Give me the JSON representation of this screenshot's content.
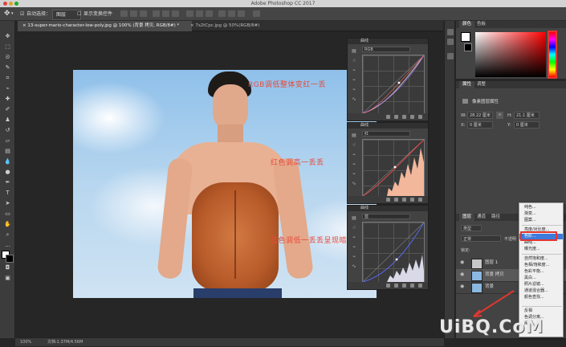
{
  "app": {
    "title": "Adobe Photoshop CC 2017"
  },
  "options_bar": {
    "auto_select_label": "自动选择：",
    "auto_select_value": "图层",
    "show_transform_label": "显示变换控件"
  },
  "tabs": [
    {
      "label": "13-super-mario-character-low-poly.jpg @ 100% (背景 拷贝, RGB/8#) *",
      "active": true
    },
    {
      "label": "7s2tCpc.jpg @ 50%(RGB/8#)",
      "active": false
    }
  ],
  "annotations": [
    "RGB调低整体变红一丢",
    "红色调高一丢丢",
    "蓝色调低一丢丢呈现暗黄小麦色"
  ],
  "curves_panels": [
    {
      "title": "曲线",
      "channel": "RGB"
    },
    {
      "title": "曲线",
      "channel": "红"
    },
    {
      "title": "曲线",
      "channel": "蓝"
    }
  ],
  "color_panel": {
    "tabs": [
      "颜色",
      "色板"
    ]
  },
  "properties_panel": {
    "tabs": [
      "属性",
      "调整"
    ],
    "pixel_layer_label": "像素图层属性",
    "w_label": "W:",
    "w_value": "28.22 厘米",
    "h_label": "H:",
    "h_value": "21.1 厘米",
    "x_label": "X:",
    "x_value": "0 厘米",
    "y_label": "Y:",
    "y_value": "0 厘米"
  },
  "layers_panel": {
    "tabs": [
      "图层",
      "通道",
      "路径"
    ],
    "filter_value": "类型",
    "blend_mode": "正常",
    "opacity_label": "不透明",
    "lock_label": "锁定:",
    "layers": [
      {
        "name": "图层 1"
      },
      {
        "name": "背景 拷贝"
      },
      {
        "name": "背景"
      }
    ]
  },
  "context_menu": {
    "items": [
      "纯色...",
      "渐变...",
      "图案...",
      "亮度/对比度...",
      "色阶...",
      "曲线...",
      "曝光度...",
      "自然饱和度...",
      "色相/饱和度...",
      "色彩平衡...",
      "黑白...",
      "照片滤镜...",
      "通道混合器...",
      "颜色查找...",
      "反相",
      "色调分离...",
      "阈值..."
    ],
    "selected_index": 4
  },
  "status_bar": {
    "zoom": "100%",
    "doc": "文档:1.37M/4.56M"
  },
  "watermark": "UiBQ.CoM",
  "colors": {
    "accent_red": "#e64b3c",
    "selection_blue": "#3c7bdc"
  }
}
